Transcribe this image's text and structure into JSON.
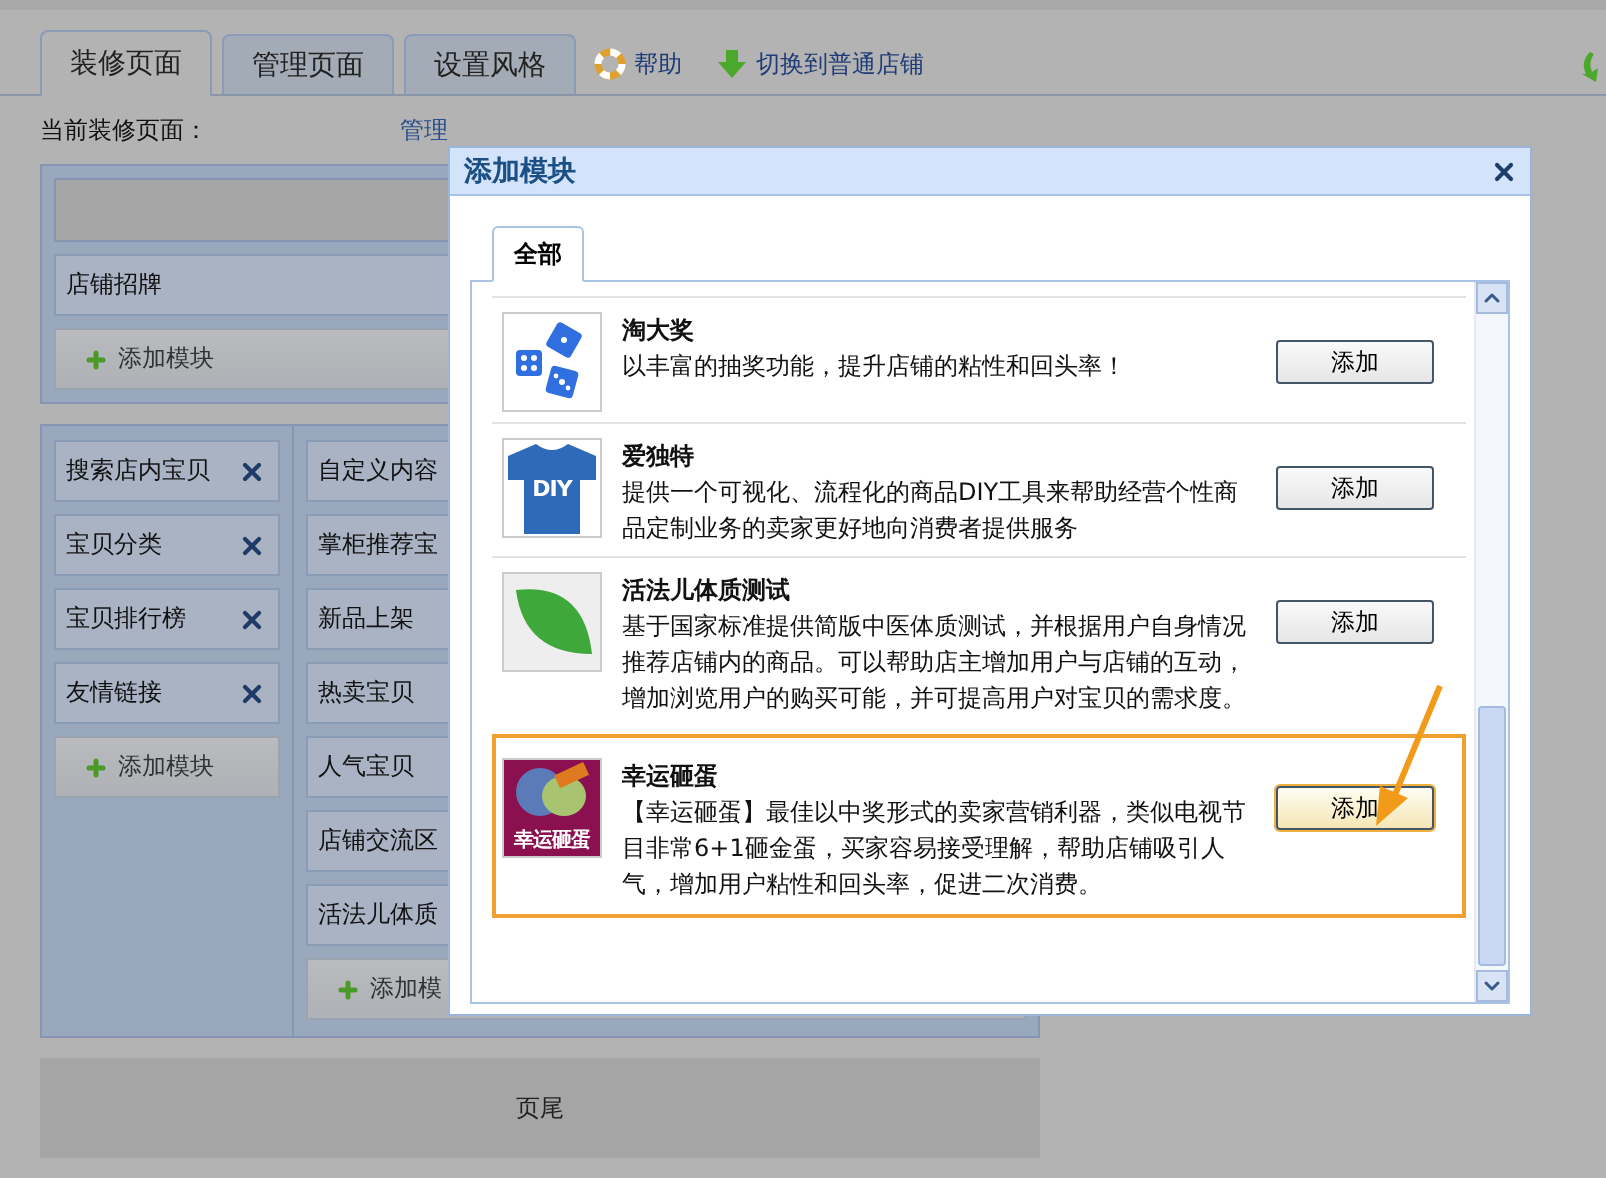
{
  "tabs": [
    {
      "label": "装修页面",
      "selected": true
    },
    {
      "label": "管理页面",
      "selected": false
    },
    {
      "label": "设置风格",
      "selected": false
    }
  ],
  "toolbar_links": [
    {
      "label": "帮助",
      "kind": "help"
    },
    {
      "label": "切换到普通店铺",
      "kind": "switch"
    }
  ],
  "current_page": {
    "label": "当前装修页面：",
    "link": "管理"
  },
  "header_section": {
    "items": [
      "店铺招牌"
    ],
    "add_button": "添加模块"
  },
  "left_column": {
    "items": [
      {
        "label": "搜索店内宝贝",
        "removable": true
      },
      {
        "label": "宝贝分类",
        "removable": true
      },
      {
        "label": "宝贝排行榜",
        "removable": true
      },
      {
        "label": "友情链接",
        "removable": true
      }
    ],
    "add_button": "添加模块"
  },
  "right_column": {
    "items": [
      {
        "label": "自定义内容"
      },
      {
        "label": "掌柜推荐宝"
      },
      {
        "label": "新品上架"
      },
      {
        "label": "热卖宝贝"
      },
      {
        "label": "人气宝贝"
      },
      {
        "label": "店铺交流区"
      },
      {
        "label": "活法儿体质"
      }
    ],
    "add_button": "添加模"
  },
  "footer": "页尾",
  "dialog": {
    "title": "添加模块",
    "tabs": [
      {
        "label": "全部",
        "selected": true
      }
    ],
    "modules": [
      {
        "name": "淘大奖",
        "description": "以丰富的抽奖功能，提升店铺的粘性和回头率！",
        "kind": "dice",
        "highlighted": false,
        "button": "添加"
      },
      {
        "name": "爱独特",
        "description": "提供一个可视化、流程化的商品DIY工具来帮助经营个性商品定制业务的卖家更好地向消费者提供服务",
        "kind": "shirt",
        "icon_text": "DIY",
        "highlighted": false,
        "button": "添加"
      },
      {
        "name": "活法儿体质测试",
        "description": "基于国家标准提供简版中医体质测试，并根据用户自身情况推荐店铺内的商品。可以帮助店主增加用户与店铺的互动，增加浏览用户的购买可能，并可提高用户对宝贝的需求度。",
        "kind": "leaf",
        "highlighted": false,
        "button": "添加"
      },
      {
        "name": "幸运砸蛋",
        "description": "【幸运砸蛋】最佳以中奖形式的卖家营销利器，类似电视节目非常6+1砸金蛋，买家容易接受理解，帮助店铺吸引人气，增加用户粘性和回头率，促进二次消费。",
        "kind": "egg",
        "icon_text": "幸运砸蛋",
        "highlighted": true,
        "button": "添加"
      }
    ]
  }
}
